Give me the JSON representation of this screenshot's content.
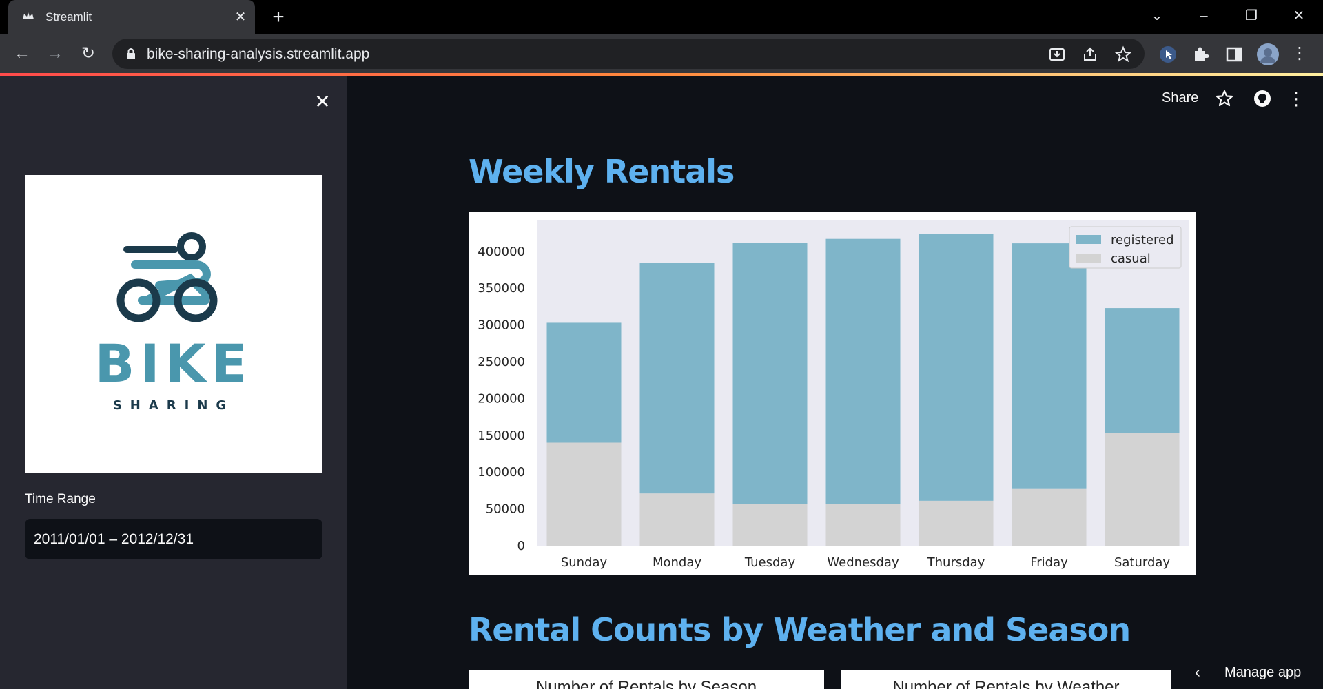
{
  "browser": {
    "tab_title": "Streamlit",
    "url": "bike-sharing-analysis.streamlit.app"
  },
  "app_header": {
    "share_label": "Share"
  },
  "sidebar": {
    "logo": {
      "word1": "BIKE",
      "word2": "SHARING"
    },
    "time_range_label": "Time Range",
    "time_range_value": "2011/01/01 – 2012/12/31"
  },
  "main": {
    "weekly_title": "Weekly Rentals",
    "weather_title": "Rental Counts by Weather and Season",
    "season_chart_title": "Number of Rentals by Season",
    "weather_chart_title": "Number of Rentals by Weather",
    "manage_app_label": "Manage app"
  },
  "colors": {
    "registered": "#7fb5c9",
    "casual": "#d3d3d3",
    "title_blue": "#5eb1ef",
    "plot_bg": "#eaeaf2"
  },
  "chart_data": {
    "type": "bar",
    "stacked": true,
    "categories": [
      "Sunday",
      "Monday",
      "Tuesday",
      "Wednesday",
      "Thursday",
      "Friday",
      "Saturday"
    ],
    "series": [
      {
        "name": "registered",
        "values": [
          163000,
          313000,
          355000,
          360000,
          363000,
          333000,
          170000
        ]
      },
      {
        "name": "casual",
        "values": [
          140000,
          71000,
          57000,
          57000,
          61000,
          78000,
          153000
        ]
      }
    ],
    "ylim": [
      0,
      442000
    ],
    "yticks": [
      "0",
      "50000",
      "100000",
      "150000",
      "200000",
      "250000",
      "300000",
      "350000",
      "400000"
    ],
    "legend": "top-right",
    "grid": false
  }
}
